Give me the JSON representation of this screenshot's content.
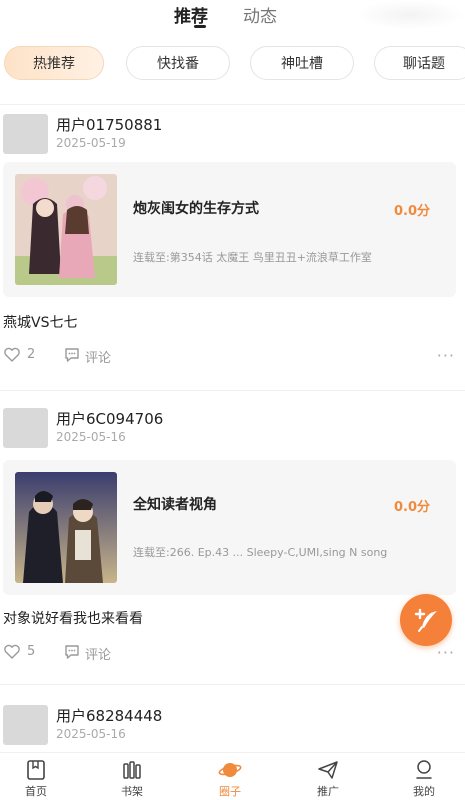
{
  "top_tabs": {
    "recommend": "推荐",
    "dynamic": "动态"
  },
  "chips": [
    "热推荐",
    "快找番",
    "神吐槽",
    "聊话题"
  ],
  "posts": [
    {
      "username": "用户01750881",
      "date": "2025-05-19",
      "book_title": "炮灰闺女的生存方式",
      "score": "0.0分",
      "chapter": "连载至:第354话 太魔王 鸟里丑丑+流浪草工作室",
      "text": "燕城VS七七",
      "likes": "2",
      "comment_label": "评论"
    },
    {
      "username": "用户6C094706",
      "date": "2025-05-16",
      "book_title": "全知读者视角",
      "score": "0.0分",
      "chapter": "连载至:266. Ep.43 ... Sleepy-C,UMI,sing N song",
      "text": "对象说好看我也来看看",
      "likes": "5",
      "comment_label": "评论"
    },
    {
      "username": "用户68284448",
      "date": "2025-05-16"
    }
  ],
  "more_symbol": "···",
  "bottom_nav": [
    {
      "label": "首页",
      "icon": "home-icon"
    },
    {
      "label": "书架",
      "icon": "bookshelf-icon"
    },
    {
      "label": "圈子",
      "icon": "planet-icon"
    },
    {
      "label": "推广",
      "icon": "paper-plane-icon"
    },
    {
      "label": "我的",
      "icon": "profile-icon"
    }
  ],
  "colors": {
    "accent": "#f08a3c",
    "fab": "#f4803a"
  }
}
